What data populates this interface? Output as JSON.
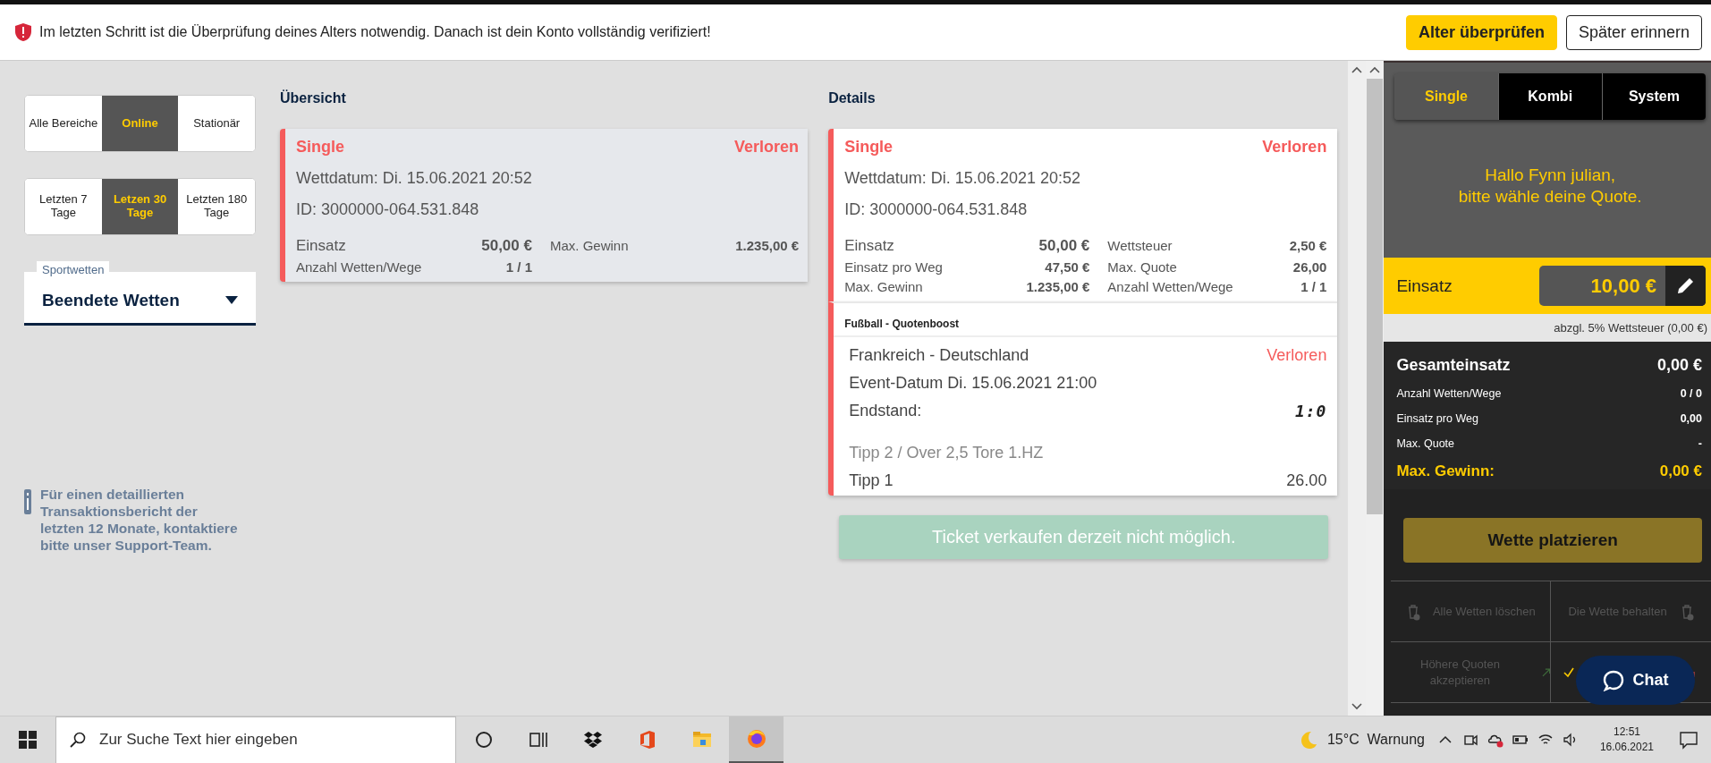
{
  "banner": {
    "message": "Im letzten Schritt ist die Überprüfung deines Alters notwendig. Danach ist dein Konto vollständig verifiziert!",
    "buttons": [
      {
        "label": "Alter überprüfen",
        "kind": "primary"
      },
      {
        "label": "Später erinnern",
        "kind": "secondary"
      }
    ]
  },
  "filters": {
    "area_tabs": [
      {
        "label": "Alle Bereiche",
        "selected": false
      },
      {
        "label": "Online",
        "selected": true
      },
      {
        "label": "Stationär",
        "selected": false
      }
    ],
    "period_tabs": [
      {
        "label": "Letzten 7 Tage",
        "selected": false
      },
      {
        "label": "Letzen 30 Tage",
        "selected": true
      },
      {
        "label": "Letzten 180 Tage",
        "selected": false
      }
    ]
  },
  "dropdown": {
    "label": "Sportwetten",
    "value": "Beendete Wetten"
  },
  "info_note": "Für einen detaillierten Transaktionsbericht der letzten 12 Monate, kontaktiere bitte unser Support-Team.",
  "overview": {
    "title": "Übersicht",
    "card": {
      "type": "Single",
      "status": "Verloren",
      "date": "Wettdatum: Di. 15.06.2021 20:52",
      "id": "ID: 3000000-064.531.848",
      "stats": [
        {
          "label": "Einsatz",
          "value": "50,00 €"
        },
        {
          "label": "Max. Gewinn",
          "value": "1.235,00 €"
        },
        {
          "label": "Anzahl Wetten/Wege",
          "value": "1 / 1"
        }
      ]
    }
  },
  "details": {
    "title": "Details",
    "card": {
      "type": "Single",
      "status": "Verloren",
      "date": "Wettdatum: Di. 15.06.2021 20:52",
      "id": "ID: 3000000-064.531.848",
      "stats": [
        {
          "label": "Einsatz",
          "value": "50,00 €"
        },
        {
          "label": "Wettsteuer",
          "value": "2,50 €"
        },
        {
          "label": "Einsatz pro Weg",
          "value": "47,50 €"
        },
        {
          "label": "Max. Quote",
          "value": "26,00"
        },
        {
          "label": "Max. Gewinn",
          "value": "1.235,00 €"
        },
        {
          "label": "Anzahl Wetten/Wege",
          "value": "1 / 1"
        }
      ]
    },
    "selection": {
      "category": "Fußball - Quotenboost",
      "match": "Frankreich - Deutschland",
      "status": "Verloren",
      "event_date": "Event-Datum Di. 15.06.2021 21:00",
      "score_label": "Endstand:",
      "score": "1:0",
      "tip_detail": "Tipp 2 / Over 2,5 Tore 1.HZ",
      "tip": "Tipp 1",
      "odds": "26.00"
    },
    "sell_button": {
      "label": "Ticket verkaufen derzeit nicht möglich.",
      "disabled": true
    }
  },
  "betslip": {
    "tabs": [
      {
        "label": "Single",
        "selected": true
      },
      {
        "label": "Kombi",
        "selected": false
      },
      {
        "label": "System",
        "selected": false
      }
    ],
    "greeting": "Hallo Fynn julian,\nbitte wähle deine Quote.",
    "stake": {
      "label": "Einsatz",
      "value": "10,00 €"
    },
    "tax_note": "abzgl. 5% Wettsteuer (0,00 €)",
    "summary": [
      {
        "label": "Gesamteinsatz",
        "value": "0,00 €",
        "kind": "total"
      },
      {
        "label": "Anzahl Wetten/Wege",
        "value": "0 / 0",
        "kind": "row"
      },
      {
        "label": "Einsatz pro Weg",
        "value": "0,00",
        "kind": "row"
      },
      {
        "label": "Max. Quote",
        "value": "-",
        "kind": "row"
      },
      {
        "label": "Max. Gewinn:",
        "value": "0,00 €",
        "kind": "highlight"
      }
    ],
    "place_button": {
      "label": "Wette platzieren",
      "disabled": true
    },
    "actions": [
      {
        "label": "Alle Wetten löschen",
        "kind": "trash-left"
      },
      {
        "label": "Die Wette behalten",
        "kind": "trash-right"
      },
      {
        "label": "Höhere Quoten akzeptieren",
        "kind": "arrow-up",
        "checked": false
      },
      {
        "kind": "arrow-down",
        "checked": true
      }
    ],
    "chat_button": "Chat"
  },
  "taskbar": {
    "search_placeholder": "Zur Suche Text hier eingeben",
    "weather": "15°C  Warnung",
    "time": "12:51",
    "date": "16.06.2021"
  }
}
